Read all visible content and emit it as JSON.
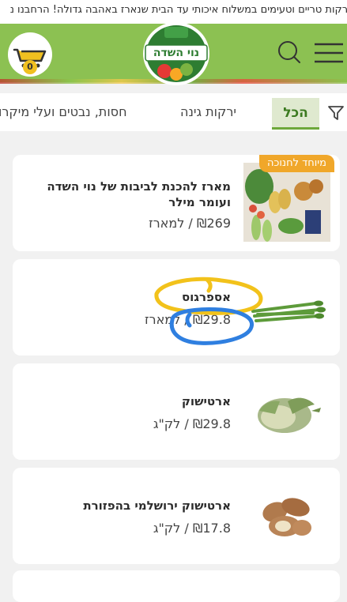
{
  "ticker": {
    "text": "ירקות טריים וטעימים במשלוח איכותי עד הבית שנארז באהבה גדולה! הרחבנו נ"
  },
  "header": {
    "logo_text": "נוי השדה",
    "cart_count": "0"
  },
  "tabs": [
    {
      "label": "הכל"
    },
    {
      "label": "ירקות גינה"
    },
    {
      "label": "חסות, נבטים ועלי מיקרו"
    }
  ],
  "products": [
    {
      "badge": "מיוחד לחנוכה",
      "title": "מארז להכנת לביבות של נוי השדה ועומר מילר",
      "price": "₪269",
      "unit": "למארז"
    },
    {
      "title": "אספרגוס",
      "price": "₪29.8",
      "unit": "למארז"
    },
    {
      "title": "ארטישוק",
      "price": "₪29.8",
      "unit": "לק\"ג"
    },
    {
      "title": "ארטישוק ירושלמי בהפזורת",
      "price": "₪17.8",
      "unit": "לק\"ג"
    }
  ],
  "colors": {
    "header": "#8cc152",
    "badge": "#f0a72a",
    "annotation_yellow": "#f2c21b",
    "annotation_blue": "#2f7fe0"
  }
}
